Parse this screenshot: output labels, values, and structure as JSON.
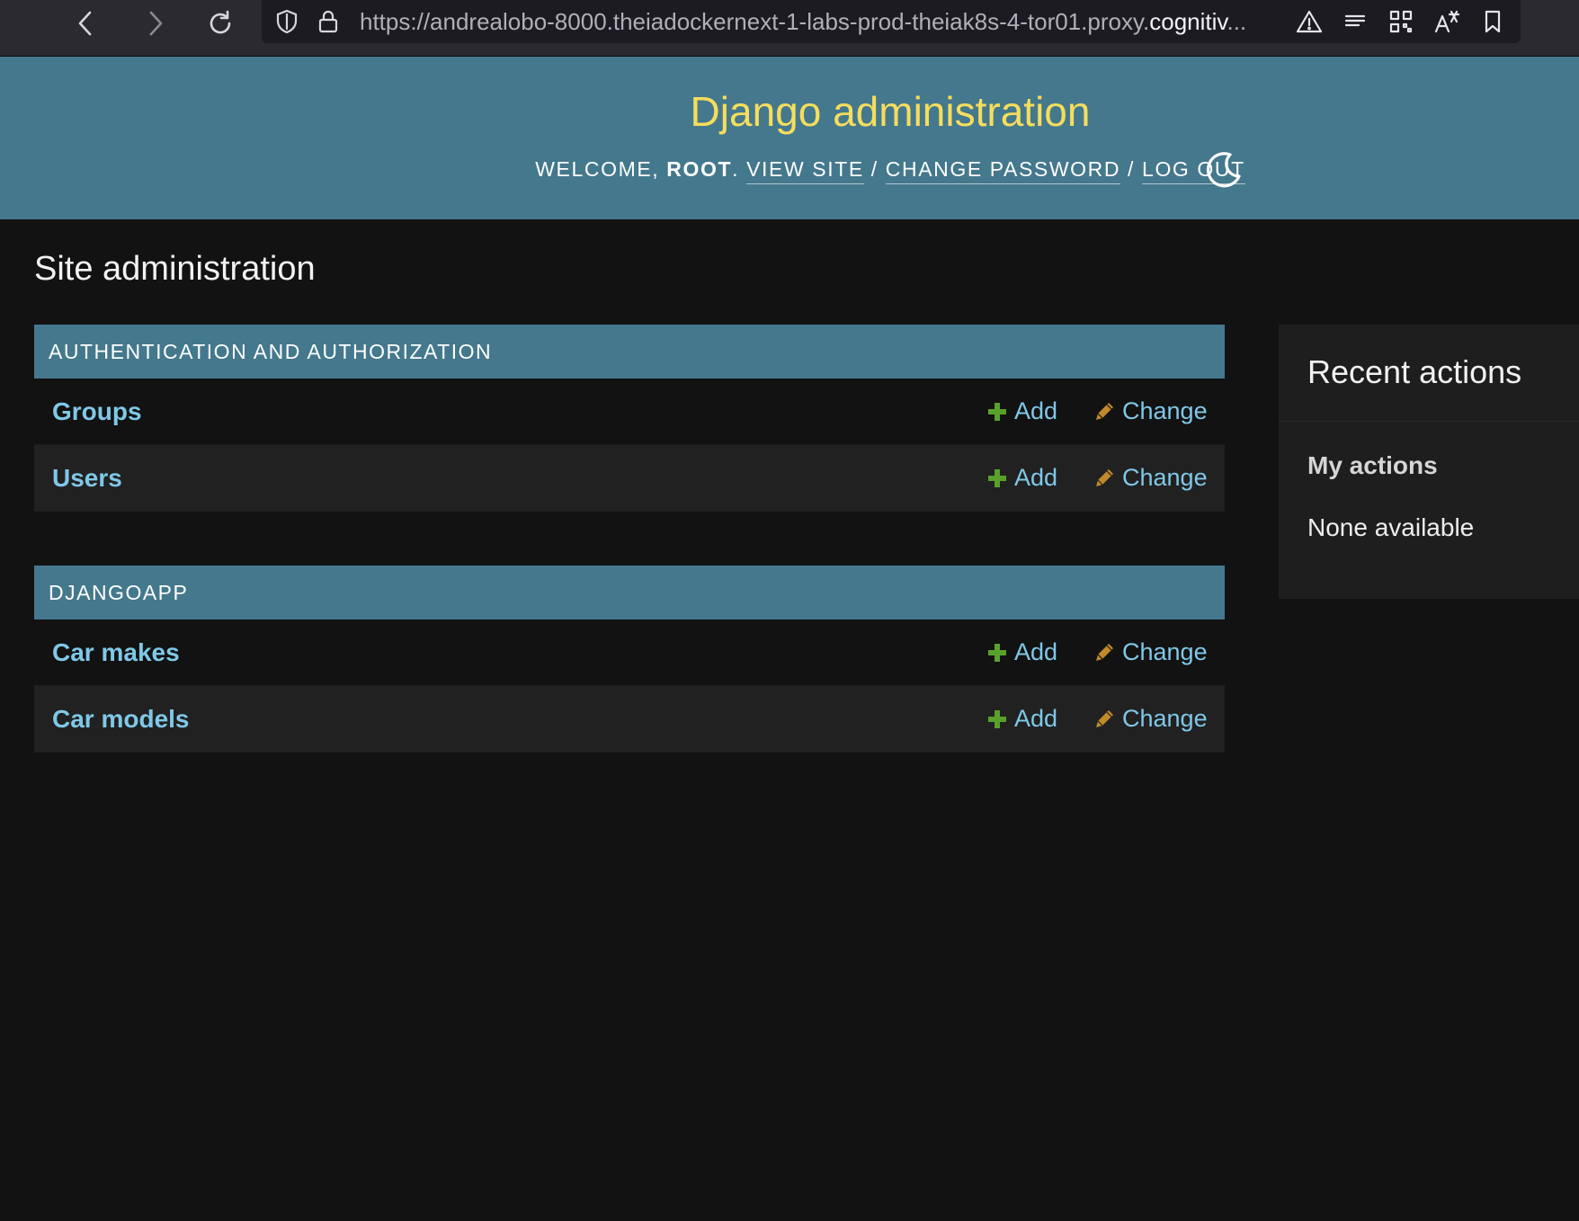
{
  "browser": {
    "url_prefix": "https://andrealobo-8000.theiadockernext-1-labs-prod-theiak8s-4-tor01.proxy.",
    "url_host": "cognitiv",
    "url_suffix": "..."
  },
  "header": {
    "title": "Django administration",
    "welcome": "WELCOME, ",
    "username": "ROOT",
    "period": ". ",
    "view_site": "VIEW SITE",
    "sep1": " / ",
    "change_password": "CHANGE PASSWORD",
    "sep2": " / ",
    "log_out": "LOG OUT"
  },
  "page_title": "Site administration",
  "modules": [
    {
      "caption": "AUTHENTICATION AND AUTHORIZATION",
      "models": [
        {
          "name": "Groups",
          "add": "Add",
          "change": "Change"
        },
        {
          "name": "Users",
          "add": "Add",
          "change": "Change"
        }
      ]
    },
    {
      "caption": "DJANGOAPP",
      "models": [
        {
          "name": "Car makes",
          "add": "Add",
          "change": "Change"
        },
        {
          "name": "Car models",
          "add": "Add",
          "change": "Change"
        }
      ]
    }
  ],
  "sidebar": {
    "title": "Recent actions",
    "my_actions": "My actions",
    "none_available": "None available"
  },
  "colors": {
    "header_bg": "#44788d",
    "brand_yellow": "#f5dd5d",
    "link_blue": "#7fc8e8",
    "add_green": "#5aa02c",
    "change_yellow": "#c08a2a"
  }
}
